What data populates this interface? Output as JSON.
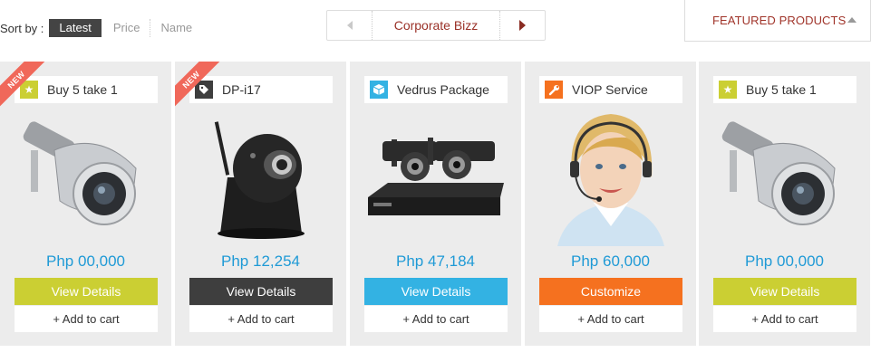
{
  "sort": {
    "label": "Sort by :",
    "options": [
      "Latest",
      "Price",
      "Name"
    ]
  },
  "pager": {
    "title": "Corporate Bizz"
  },
  "featured": {
    "label": "FEATURED PRODUCTS"
  },
  "colors": {
    "green": "#cbcf33",
    "dark": "#3e3e3e",
    "blue": "#33b2e3",
    "orange": "#f5711f",
    "price": "#1f9ad6",
    "ribbon": "#f0685a"
  },
  "cards": [
    {
      "title": "Buy 5 take 1",
      "icon": "star-icon",
      "badge": "NEW",
      "image": "security-camera",
      "price": "Php 00,000",
      "button": "View Details",
      "cart": "+ Add to cart"
    },
    {
      "title": "DP-i17",
      "icon": "tag-icon",
      "badge": "NEW",
      "image": "pan-tilt-camera",
      "price": "Php 12,254",
      "button": "View Details",
      "cart": "+ Add to cart"
    },
    {
      "title": "Vedrus Package",
      "icon": "box-icon",
      "image": "dvr-camera-package",
      "price": "Php 47,184",
      "button": "View Details",
      "cart": "+ Add to cart"
    },
    {
      "title": "VIOP Service",
      "icon": "wrench-icon",
      "image": "headset-operator",
      "price": "Php 60,000",
      "button": "Customize",
      "cart": "+ Add to cart"
    },
    {
      "title": "Buy 5 take 1",
      "icon": "star-icon",
      "image": "security-camera",
      "price": "Php 00,000",
      "button": "View Details",
      "cart": "+ Add to cart"
    }
  ]
}
